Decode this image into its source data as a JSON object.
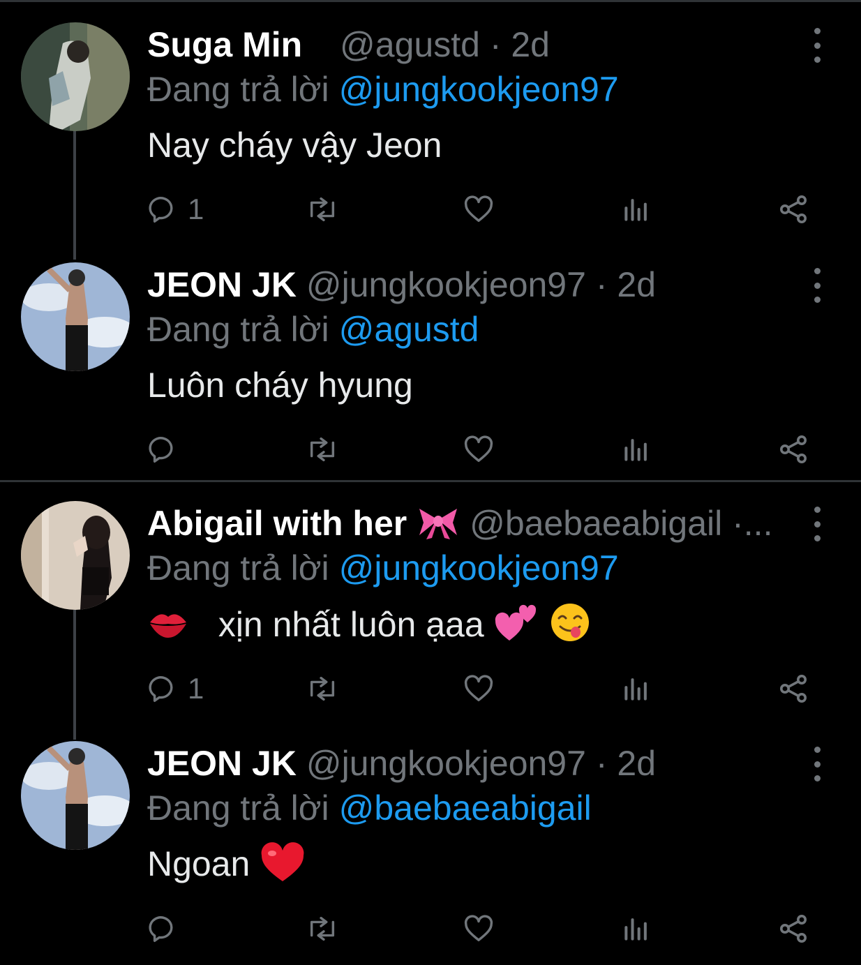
{
  "colors": {
    "background": "#000000",
    "text": "#e7e9ea",
    "muted": "#71767b",
    "mention": "#1d9bf0",
    "divider": "#2f3336"
  },
  "tweets": [
    {
      "name": "Suga Min",
      "handle": "@agustd",
      "time": "· 2d",
      "reply_prefix": "Đang trả lời",
      "reply_to": "@jungkookjeon97",
      "text": "Nay cháy vậy Jeon",
      "reply_count": "1"
    },
    {
      "name": "JEON JK",
      "handle": "@jungkookjeon97",
      "time": "· 2d",
      "reply_prefix": "Đang trả lời",
      "reply_to": "@agustd",
      "text": "Luôn cháy hyung",
      "reply_count": ""
    },
    {
      "name": "Abigail with her",
      "name_emoji": "ribbon-emoji",
      "handle": "@baebaeabigail",
      "time": "·...",
      "reply_prefix": "Đang trả lời",
      "reply_to": "@jungkookjeon97",
      "text": "xịn nhất luôn ạaa",
      "text_emojis": [
        "kiss-mark-emoji",
        "two-hearts-emoji",
        "yum-face-emoji"
      ],
      "reply_count": "1"
    },
    {
      "name": "JEON JK",
      "handle": "@jungkookjeon97",
      "time": "· 2d",
      "reply_prefix": "Đang trả lời",
      "reply_to": "@baebaeabigail",
      "text": "Ngoan",
      "text_emojis": [
        "red-heart-emoji"
      ],
      "reply_count": ""
    }
  ],
  "icons": {
    "reply": "reply-icon",
    "retweet": "retweet-icon",
    "like": "like-icon",
    "views": "views-icon",
    "share": "share-icon",
    "more": "more-options-icon"
  }
}
